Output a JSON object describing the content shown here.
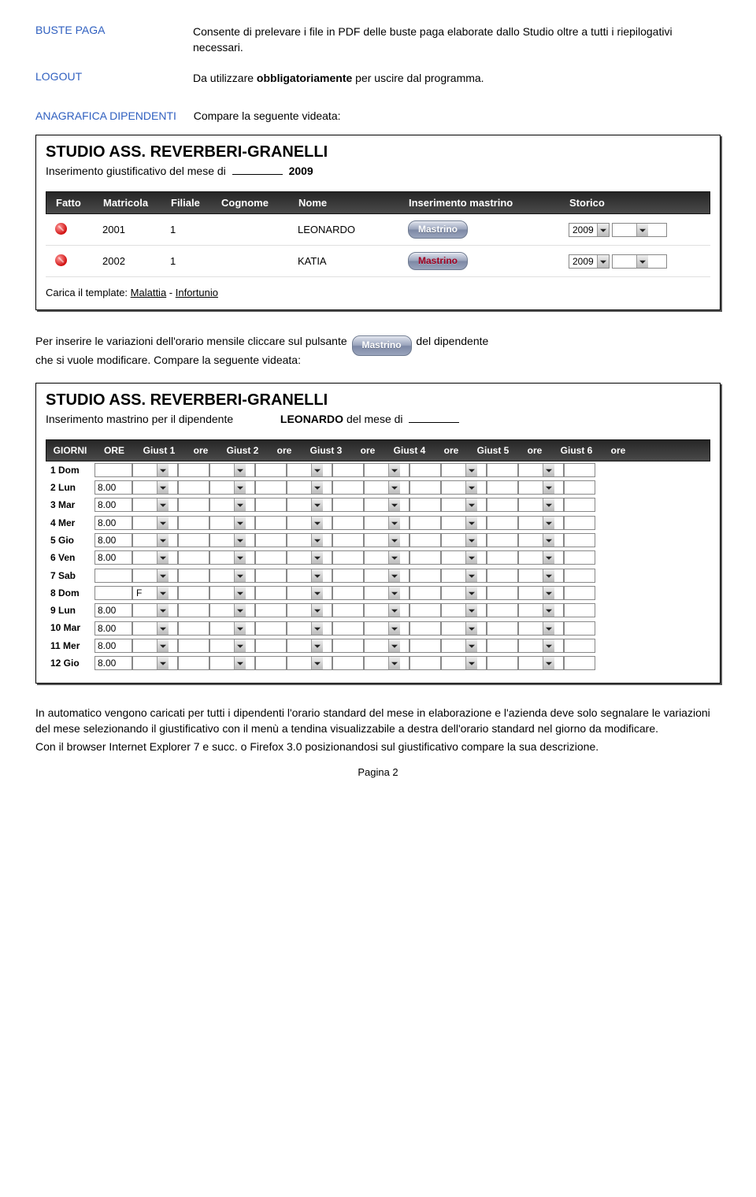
{
  "defs": {
    "buste_label": "BUSTE PAGA",
    "buste_text": "Consente di prelevare i file in PDF delle buste paga elaborate dallo Studio oltre a tutti i riepilogativi necessari.",
    "logout_label": "LOGOUT",
    "logout_pre": "Da utilizzare ",
    "logout_bold": "obbligatoriamente",
    "logout_post": " per uscire dal programma.",
    "anag_label": "ANAGRAFICA DIPENDENTI",
    "anag_text": "Compare la seguente videata:"
  },
  "win1": {
    "studio": "STUDIO ASS. REVERBERI-GRANELLI",
    "sub_pre": "Inserimento giustificativo del mese di",
    "year": "2009",
    "hdr": {
      "fatto": "Fatto",
      "matricola": "Matricola",
      "filiale": "Filiale",
      "cognome": "Cognome",
      "nome": "Nome",
      "ins": "Inserimento mastrino",
      "storico": "Storico"
    },
    "rows": [
      {
        "matr": "2001",
        "fil": "1",
        "cog": "",
        "nome": "LEONARDO",
        "btn": "Mastrino",
        "btnRed": false,
        "yr": "2009"
      },
      {
        "matr": "2002",
        "fil": "1",
        "cog": "",
        "nome": "KATIA",
        "btn": "Mastrino",
        "btnRed": true,
        "yr": "2009"
      }
    ],
    "tmpl_pre": "Carica il template: ",
    "tmpl1": "Malattia",
    "tmpl2": "Infortunio"
  },
  "between": {
    "line1a": "Per inserire le variazioni dell'orario mensile cliccare sul pulsante",
    "line1b": "del dipendente",
    "mastrino_btn": "Mastrino",
    "line2": "che si vuole modificare. Compare la seguente videata:"
  },
  "win2": {
    "studio": "STUDIO ASS. REVERBERI-GRANELLI",
    "sub_pre": "Inserimento mastrino per il dipendente",
    "emp": "LEONARDO",
    "sub_post": "del mese di",
    "hdr": {
      "giorni": "GIORNI",
      "ore": "ORE",
      "gi1": "Giust 1",
      "go1": "ore",
      "gi2": "Giust 2",
      "go2": "ore",
      "gi3": "Giust 3",
      "go3": "ore",
      "gi4": "Giust 4",
      "go4": "ore",
      "gi5": "Giust 5",
      "go5": "ore",
      "gi6": "Giust 6",
      "go6": "ore"
    },
    "days": [
      {
        "n": "1",
        "d": "Dom",
        "ore": "",
        "j1": ""
      },
      {
        "n": "2",
        "d": "Lun",
        "ore": "8.00",
        "j1": ""
      },
      {
        "n": "3",
        "d": "Mar",
        "ore": "8.00",
        "j1": ""
      },
      {
        "n": "4",
        "d": "Mer",
        "ore": "8.00",
        "j1": ""
      },
      {
        "n": "5",
        "d": "Gio",
        "ore": "8.00",
        "j1": ""
      },
      {
        "n": "6",
        "d": "Ven",
        "ore": "8.00",
        "j1": ""
      },
      {
        "n": "7",
        "d": "Sab",
        "ore": "",
        "j1": ""
      },
      {
        "n": "8",
        "d": "Dom",
        "ore": "",
        "j1": "F"
      },
      {
        "n": "9",
        "d": "Lun",
        "ore": "8.00",
        "j1": ""
      },
      {
        "n": "10",
        "d": "Mar",
        "ore": "8.00",
        "j1": ""
      },
      {
        "n": "11",
        "d": "Mer",
        "ore": "8.00",
        "j1": ""
      },
      {
        "n": "12",
        "d": "Gio",
        "ore": "8.00",
        "j1": ""
      }
    ]
  },
  "bottom": {
    "p1": "In automatico vengono caricati per tutti i dipendenti l'orario standard del mese in elaborazione e l'azienda deve solo segnalare le variazioni del mese selezionando il giustificativo con il menù a tendina visualizzabile a destra dell'orario standard nel giorno da modificare.",
    "p2": "Con il browser Internet Explorer 7 e succ. o Firefox 3.0 posizionandosi sul giustificativo compare la sua descrizione."
  },
  "footer": "Pagina 2"
}
